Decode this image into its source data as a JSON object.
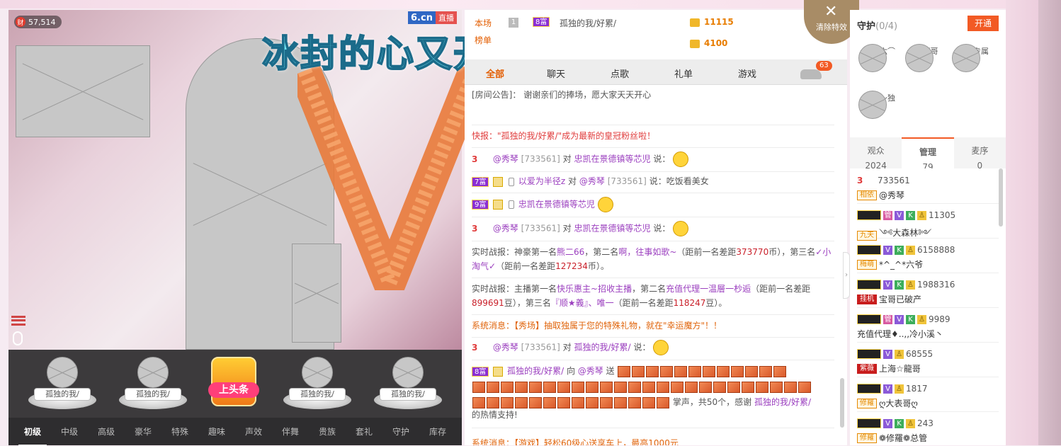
{
  "video": {
    "wealth_value": "57,514",
    "wealth_icon": "财",
    "logo": "6.cn",
    "live_label": "直播",
    "lyric": "冰封的心又开始回温 嗨"
  },
  "stage": {
    "seats": [
      "孤独的我/",
      "孤独的我/",
      "孤独的我/",
      "孤独的我/"
    ],
    "headline": "上头条"
  },
  "gift_tabs": [
    "初级",
    "中级",
    "高级",
    "豪华",
    "特殊",
    "趣味",
    "声效",
    "伴舞",
    "贵族",
    "套礼",
    "守护",
    "库存"
  ],
  "ranking": {
    "label1": "本场",
    "label2": "榜单",
    "rank": "1",
    "wealth": "8富",
    "name": "孤独的我/好累/",
    "value1": "11115",
    "value2": "4100"
  },
  "chat_tabs": {
    "all": "全部",
    "chat": "聊天",
    "song": "点歌",
    "gift": "礼单",
    "game": "游戏",
    "car_count": "63"
  },
  "chat": {
    "notice_label": "[房间公告]：",
    "notice_text": "谢谢亲们的捧场，愿大家天天开心",
    "flash": "快报：\"孤独的我/好累/\"成为最新的皇冠粉丝啦！",
    "m1_level": "3",
    "m1_from": "@秀琴",
    "m1_id": "[733561]",
    "m1_to_word": "对",
    "m1_to": "忠凯在景德镇等芯児",
    "m1_say": "说：",
    "m2_wealth": "7富",
    "m2_from": "以爱为半径z",
    "m2_to_word": "对",
    "m2_to": "@秀琴",
    "m2_id": "[733561]",
    "m2_say": "说：吃饭看美女",
    "m3_wealth": "9富",
    "m3_from": "忠凯在景德镇等芯児",
    "m4_level": "3",
    "m4_from": "@秀琴",
    "m4_id": "[733561]",
    "m4_to_word": "对",
    "m4_to": "忠凯在景德镇等芯児",
    "m4_say": "说：",
    "battle1_a": "实时战报：神豪第一名",
    "battle1_b": "熊二66",
    "battle1_c": "，第二名",
    "battle1_d": "啊，往事如歌~",
    "battle1_e": "（距前一名差距",
    "battle1_f": "373770",
    "battle1_g": "币），第三名",
    "battle1_h": "✓小淘气✓",
    "battle1_i": "（距前一名差距",
    "battle1_j": "127234",
    "battle1_k": "币）。",
    "battle2_a": "实时战报：主播第一名",
    "battle2_b": "快乐惠主~招收主播",
    "battle2_c": "，第二名",
    "battle2_d": "充值代理一温層一杪逅",
    "battle2_e": "（距前一名差距",
    "battle2_f": "899691",
    "battle2_g": "豆），第三名",
    "battle2_h": "『顺★義』、唯一",
    "battle2_i": "（距前一名差距",
    "battle2_j": "118247",
    "battle2_k": "豆）。",
    "sys_label": "系统消息：",
    "sys_text": "【秀场】抽取独属于您的特殊礼物，就在\"幸运魔方\"！！",
    "m5_level": "3",
    "m5_from": "@秀琴",
    "m5_id": "[733561]",
    "m5_to_word": "对",
    "m5_to": "孤独的我/好累/",
    "m5_say": "说：",
    "g_wealth": "8富",
    "g_from": "孤独的我/好累/",
    "g_to_word": "向",
    "g_to": "@秀琴",
    "g_send": "送",
    "g_tail_a": "掌声，共50个，感谢",
    "g_tail_b": "孤独的我/好累/",
    "g_tail_c": "的热情支持!",
    "sys2_label": "系统消息：",
    "sys2_text": "【游戏】轻松60级心送享车上，最高1000元"
  },
  "clear_effects": "清除特效",
  "guard": {
    "title": "守护",
    "count": "(0/4)",
    "open_btn": "开通",
    "members": [
      "一十六⌒",
      "啊辆哥",
      "秀琴专属",
      "相依～独"
    ]
  },
  "audience_tabs": [
    {
      "label": "观众",
      "count": "2024"
    },
    {
      "label": "管理",
      "count": "79"
    },
    {
      "label": "麦序",
      "count": "0"
    }
  ],
  "users": [
    {
      "badge": "3",
      "id": "733561",
      "tag": "相依",
      "name": "@秀琴"
    },
    {
      "id": "11305",
      "tag": "九天",
      "name": "༺大森林༻"
    },
    {
      "id": "6158888",
      "tag": "梅萌",
      "name": "*^_^*六爷"
    },
    {
      "id": "1988316",
      "tag": "挂机",
      "name": "宝哥已破产"
    },
    {
      "id": "9989",
      "tag": "",
      "name": "充值代理♦..,,冷小溪丶"
    },
    {
      "id": "68555",
      "tag": "紫薇",
      "name": "上海☆龍哥"
    },
    {
      "id": "1817",
      "tag": "修羅",
      "name": "ღ大表哥ღ"
    },
    {
      "id": "243",
      "tag": "修羅",
      "name": "❁修羅❁总管"
    }
  ],
  "collapse_arrow": "›"
}
